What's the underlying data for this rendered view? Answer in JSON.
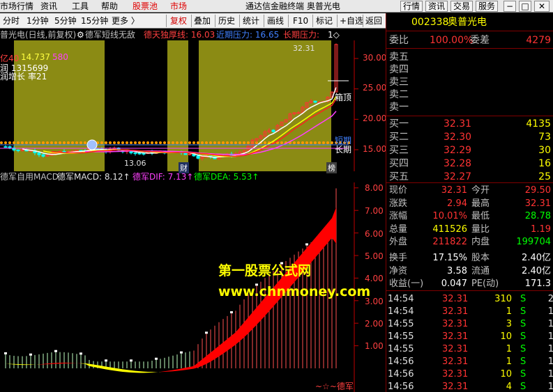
{
  "menubar": {
    "items": [
      "市场行情",
      "资讯",
      "工具",
      "帮助",
      "股票池",
      "市场"
    ],
    "title": "通达信金融终端  奥普光电",
    "buttons": [
      "行情",
      "资讯",
      "交易",
      "服务"
    ]
  },
  "toolbar": {
    "periods": [
      "分时",
      "1分钟",
      "5分钟",
      "15分钟",
      "更多 〉"
    ],
    "tools": [
      "复权",
      "叠加",
      "历史",
      "统计",
      "画线",
      "F10",
      "标记",
      "+自选",
      "返回"
    ]
  },
  "info": {
    "stock": "普光电(日线,前复权)",
    "indicator": "德军短线无敌",
    "l1": "德天独厚线: 16.03",
    "l2": "近期压力: 16.65",
    "l3": "长期压力:",
    "l4": "1◇"
  },
  "candle_panel": {
    "ylabels": [
      "30.00",
      "25.00",
      "20.00",
      "15.00"
    ],
    "ylabel_values": [
      30,
      25,
      20,
      15
    ],
    "overlays": {
      "a": "亿40",
      "b": "14.737",
      "c": "580",
      "d": "润 1315699",
      "e": "润增长",
      "f": "率21"
    },
    "peak_label": "32.31",
    "low_label": "13.06",
    "tag_box": "箱顶",
    "tag_short": "短期",
    "tag_long": "长期",
    "tag_cai": "财",
    "tag_bang": "榜"
  },
  "macd_info": {
    "name": "德军自用MACD",
    "macd": "德军MACD: 8.12↑",
    "dif": "德军DIF: 7.13↑",
    "dea": "德军DEA: 5.53↑"
  },
  "macd_panel": {
    "ylabels": [
      "8.00",
      "7.00",
      "6.00",
      "5.00",
      "4.00",
      "3.00",
      "2.00",
      "1.00"
    ],
    "ylabel_values": [
      8,
      7,
      6,
      5,
      4,
      3,
      2,
      1
    ],
    "footer": "~☆~德军"
  },
  "watermark": {
    "line1": "第一股票公式网",
    "line2": "www.chnmoney.com"
  },
  "quote": {
    "code": "002338",
    "name": "奥普光电",
    "weibi_label": "委比",
    "weibi": "100.00%",
    "weicha_label": "委差",
    "weicha": "4279",
    "sells": [
      "卖五",
      "卖四",
      "卖三",
      "卖二",
      "卖一"
    ],
    "buys": [
      {
        "label": "买一",
        "price": "32.31",
        "vol": "4135"
      },
      {
        "label": "买二",
        "price": "32.30",
        "vol": "73"
      },
      {
        "label": "买三",
        "price": "32.29",
        "vol": "30"
      },
      {
        "label": "买四",
        "price": "32.28",
        "vol": "16"
      },
      {
        "label": "买五",
        "price": "32.27",
        "vol": "25"
      }
    ],
    "stats": [
      {
        "l1": "现价",
        "v1": "32.31",
        "c1": "#ff3333",
        "l2": "今开",
        "v2": "29.50",
        "c2": "#ff3333"
      },
      {
        "l1": "涨跌",
        "v1": "2.94",
        "c1": "#ff3333",
        "l2": "最高",
        "v2": "32.31",
        "c2": "#ff3333"
      },
      {
        "l1": "涨幅",
        "v1": "10.01%",
        "c1": "#ff3333",
        "l2": "最低",
        "v2": "28.78",
        "c2": "#00ff00"
      },
      {
        "l1": "总量",
        "v1": "411526",
        "c1": "#ffff00",
        "l2": "量比",
        "v2": "1.19",
        "c2": "#ff3333"
      },
      {
        "l1": "外盘",
        "v1": "211822",
        "c1": "#ff3333",
        "l2": "内盘",
        "v2": "199704",
        "c2": "#00ff00"
      },
      {
        "l1": "换手",
        "v1": "17.15%",
        "c1": "#ffffff",
        "l2": "股本",
        "v2": "2.40亿",
        "c2": "#ffffff"
      },
      {
        "l1": "净资",
        "v1": "3.58",
        "c1": "#ffffff",
        "l2": "流通",
        "v2": "2.40亿",
        "c2": "#ffffff"
      },
      {
        "l1": "收益(一)",
        "v1": "0.047",
        "c1": "#ffffff",
        "l2": "PE(动)",
        "v2": "171.3",
        "c2": "#ffffff"
      }
    ],
    "ticks": [
      {
        "time": "14:54",
        "price": "32.31",
        "vol": "310",
        "bs": "S",
        "n": "2"
      },
      {
        "time": "14:54",
        "price": "32.31",
        "vol": "1",
        "bs": "S",
        "n": "1"
      },
      {
        "time": "14:55",
        "price": "32.31",
        "vol": "3",
        "bs": "S",
        "n": "1"
      },
      {
        "time": "14:55",
        "price": "32.31",
        "vol": "10",
        "bs": "S",
        "n": "1"
      },
      {
        "time": "14:55",
        "price": "32.31",
        "vol": "1",
        "bs": "S",
        "n": "1"
      },
      {
        "time": "14:56",
        "price": "32.31",
        "vol": "1",
        "bs": "S",
        "n": "1"
      },
      {
        "time": "14:56",
        "price": "32.31",
        "vol": "10",
        "bs": "S",
        "n": "1"
      },
      {
        "time": "14:56",
        "price": "32.31",
        "vol": "4",
        "bs": "S",
        "n": "1"
      }
    ]
  },
  "colors": {
    "olive": "#8b8b14",
    "up": "#ff3333",
    "down": "#00ffff",
    "macd_ribbon_up": "#ff0000",
    "macd_ribbon_down": "#ffff00",
    "axis": "#c00000",
    "label_red": "#ff4040"
  }
}
